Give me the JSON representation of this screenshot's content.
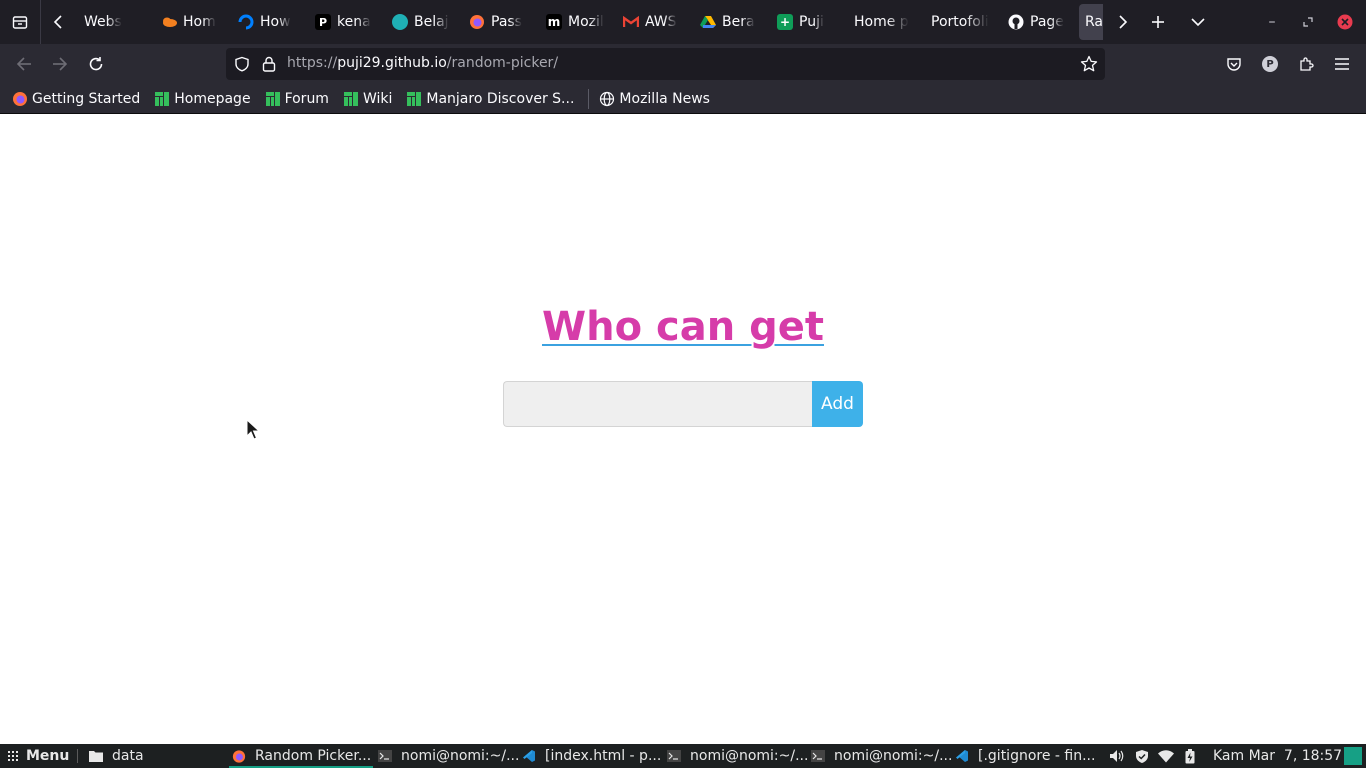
{
  "browser": {
    "tabs": [
      {
        "title": "Webs",
        "icon": "generic"
      },
      {
        "title": "Hom",
        "icon": "cloudflare-icon"
      },
      {
        "title": "How",
        "icon": "digitalocean-icon"
      },
      {
        "title": "kena",
        "icon": "p-icon"
      },
      {
        "title": "Belaj",
        "icon": "teal-icon"
      },
      {
        "title": "Pass",
        "icon": "firefox-icon"
      },
      {
        "title": "Mozil",
        "icon": "medium-icon"
      },
      {
        "title": "AWS",
        "icon": "gmail-icon"
      },
      {
        "title": "Bera",
        "icon": "drive-icon"
      },
      {
        "title": "Puji",
        "icon": "sheets-icon"
      },
      {
        "title": "Home p",
        "icon": "none"
      },
      {
        "title": "Portofoli",
        "icon": "none"
      },
      {
        "title": "Page",
        "icon": "github-icon"
      },
      {
        "title": "Rando",
        "icon": "none",
        "active": true
      }
    ],
    "url": {
      "scheme": "https://",
      "host": "puji29.github.io",
      "path": "/random-picker/"
    },
    "bookmarks": [
      {
        "label": "Getting Started",
        "icon": "firefox-icon"
      },
      {
        "label": "Homepage",
        "icon": "manjaro-icon"
      },
      {
        "label": "Forum",
        "icon": "manjaro-icon"
      },
      {
        "label": "Wiki",
        "icon": "manjaro-icon"
      },
      {
        "label": "Manjaro Discover S...",
        "icon": "manjaro-icon"
      },
      {
        "label": "Mozilla News",
        "icon": "globe-icon"
      }
    ],
    "profile_initial": "P"
  },
  "page": {
    "heading": "Who can get",
    "input_value": "",
    "add_button": "Add"
  },
  "taskbar": {
    "menu_label": "Menu",
    "items": [
      {
        "label": "data",
        "icon": "folder-icon"
      },
      {
        "label": "Random Picker...",
        "icon": "firefox-icon",
        "active": true
      },
      {
        "label": "nomi@nomi:~/...",
        "icon": "terminal-icon"
      },
      {
        "label": "[index.html - p...",
        "icon": "vscode-icon"
      },
      {
        "label": "nomi@nomi:~/...",
        "icon": "terminal-icon"
      },
      {
        "label": "nomi@nomi:~/...",
        "icon": "terminal-icon"
      },
      {
        "label": "[.gitignore - fin...",
        "icon": "vscode-icon"
      }
    ],
    "clock": "Kam Mar  7, 18:57"
  },
  "colors": {
    "heading": "#d63ca9",
    "underline": "#3ba2e0",
    "add_button": "#3eb1e9",
    "taskbar_accent": "#16a085"
  }
}
